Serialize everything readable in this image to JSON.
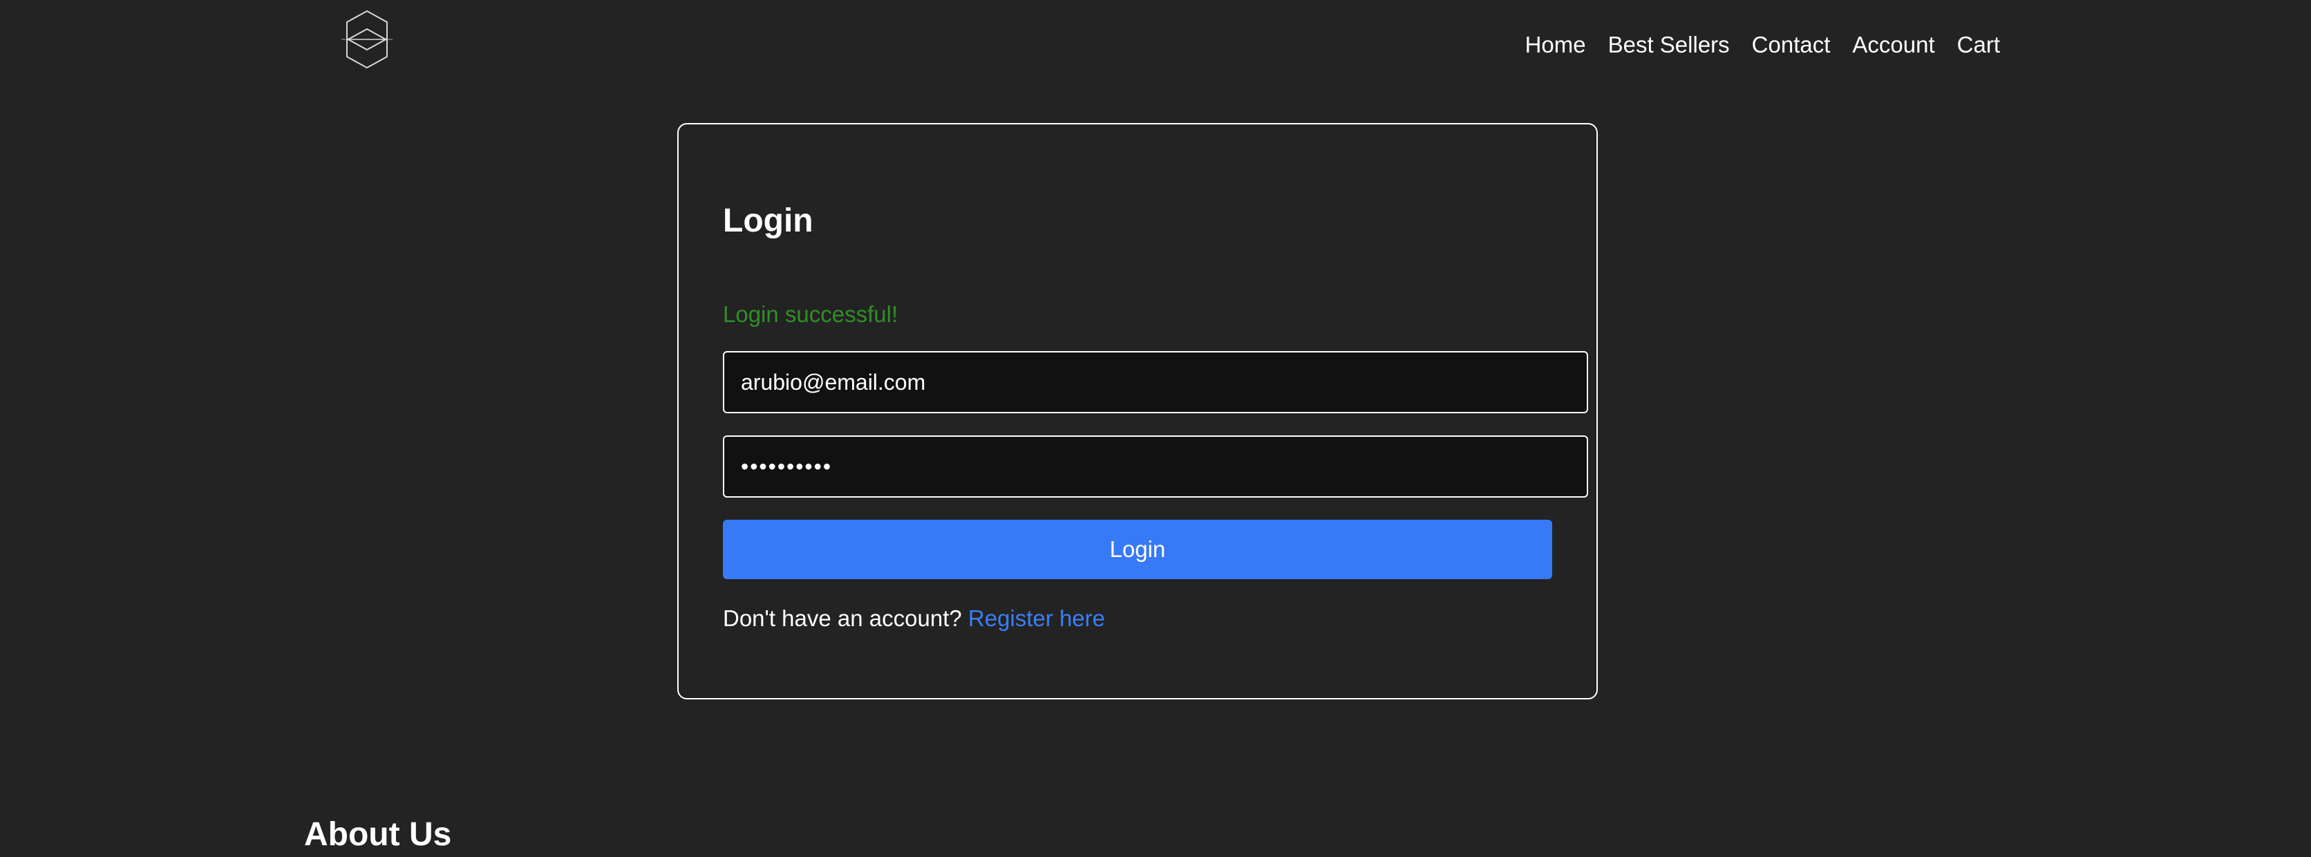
{
  "header": {
    "logo_icon": "hexagon-logo-icon",
    "nav": {
      "home": "Home",
      "best_sellers": "Best Sellers",
      "contact": "Contact",
      "account": "Account",
      "cart": "Cart"
    }
  },
  "login": {
    "title": "Login",
    "status": "Login successful!",
    "email_value": "arubio@email.com",
    "password_value": "••••••••••",
    "button_label": "Login",
    "register_prompt": "Don't have an account?",
    "register_link": "Register here"
  },
  "footer": {
    "about_heading": "About Us"
  },
  "colors": {
    "background": "#232323",
    "accent": "#3879f5",
    "link": "#3a7ff6",
    "success": "#2f8f26",
    "input_bg": "#111111"
  }
}
